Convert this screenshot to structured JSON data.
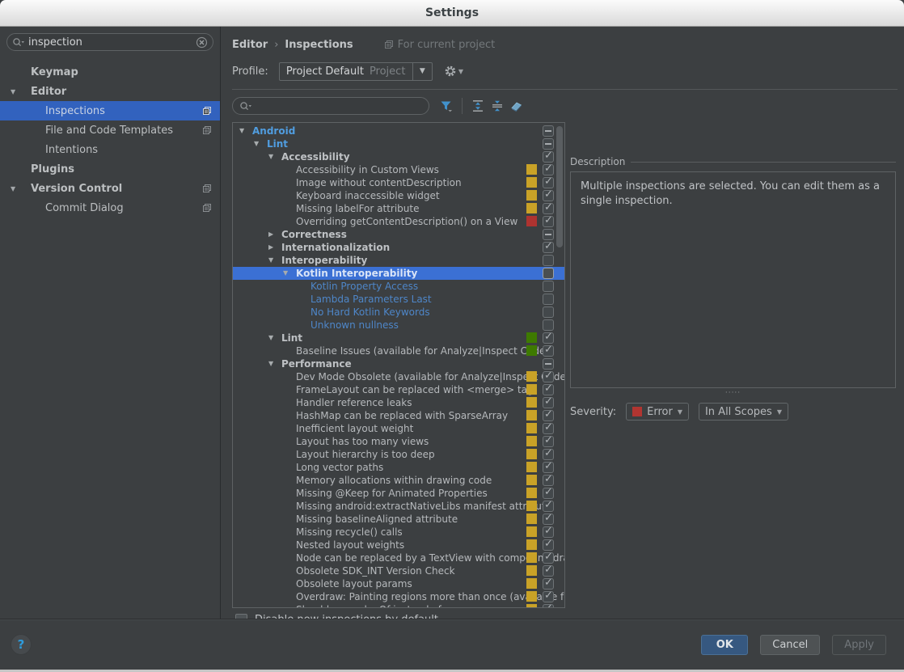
{
  "window": {
    "title": "Settings",
    "help_glyph": "?"
  },
  "sidebar": {
    "search": {
      "value": "inspection",
      "left_icon": "magnifier-with-dropdown-icon",
      "right_icon": "clear-circle-icon"
    },
    "items": [
      {
        "label": "Keymap",
        "style": "group"
      },
      {
        "label": "Editor",
        "style": "group",
        "arrow": "down"
      },
      {
        "label": "Inspections",
        "style": "child",
        "selected": true,
        "icon": true
      },
      {
        "label": "File and Code Templates",
        "style": "child",
        "icon": true
      },
      {
        "label": "Intentions",
        "style": "child"
      },
      {
        "label": "Plugins",
        "style": "group"
      },
      {
        "label": "Version Control",
        "style": "group",
        "arrow": "down",
        "icon": true
      },
      {
        "label": "Commit Dialog",
        "style": "child",
        "icon": true
      }
    ]
  },
  "header": {
    "breadcrumb": [
      "Editor",
      "Inspections"
    ],
    "separator": "›",
    "context": {
      "icon": "copy-pages-icon",
      "label": "For current project"
    }
  },
  "profile": {
    "label": "Profile:",
    "value": "Project Default",
    "scope": "Project",
    "gear_icon": "gear-with-dropdown-icon"
  },
  "tree_toolbar": {
    "search": {
      "value": ""
    },
    "icons": [
      "filter-funnel-icon",
      "expand-all-icon",
      "collapse-all-icon",
      "reset-eraser-icon"
    ]
  },
  "severity_colors": {
    "yellow": "#C9A227",
    "red": "#AE3330",
    "green": "#3E7A00"
  },
  "inspection_tree": {
    "rows": [
      {
        "label": "Android",
        "level": 0,
        "arrow": "down",
        "style": "cat-blue",
        "check": "dash"
      },
      {
        "label": "Lint",
        "level": 1,
        "arrow": "down",
        "style": "cat-blue",
        "check": "dash"
      },
      {
        "label": "Accessibility",
        "level": 2,
        "arrow": "down",
        "style": "cat",
        "check": "check"
      },
      {
        "label": "Accessibility in Custom Views",
        "level": 3,
        "style": "item",
        "sev": "yellow",
        "check": "check"
      },
      {
        "label": "Image without contentDescription",
        "level": 3,
        "style": "item",
        "sev": "yellow",
        "check": "check"
      },
      {
        "label": "Keyboard inaccessible widget",
        "level": 3,
        "style": "item",
        "sev": "yellow",
        "check": "check"
      },
      {
        "label": "Missing labelFor attribute",
        "level": 3,
        "style": "item",
        "sev": "yellow",
        "check": "check"
      },
      {
        "label": "Overriding getContentDescription() on a View",
        "level": 3,
        "style": "item",
        "sev": "red",
        "check": "check"
      },
      {
        "label": "Correctness",
        "level": 2,
        "arrow": "right",
        "style": "cat",
        "check": "dash"
      },
      {
        "label": "Internationalization",
        "level": 2,
        "arrow": "right",
        "style": "cat",
        "check": "check"
      },
      {
        "label": "Interoperability",
        "level": 2,
        "arrow": "down",
        "style": "cat",
        "check": "empty"
      },
      {
        "label": "Kotlin Interoperability",
        "level": 3,
        "arrow": "down",
        "style": "cat-sel",
        "check": "empty",
        "selected": true
      },
      {
        "label": "Kotlin Property Access",
        "level": 4,
        "style": "item-blue",
        "check": "empty"
      },
      {
        "label": "Lambda Parameters Last",
        "level": 4,
        "style": "item-blue",
        "check": "empty"
      },
      {
        "label": "No Hard Kotlin Keywords",
        "level": 4,
        "style": "item-blue",
        "check": "empty"
      },
      {
        "label": "Unknown nullness",
        "level": 4,
        "style": "item-blue",
        "check": "empty"
      },
      {
        "label": "Lint",
        "level": 2,
        "arrow": "down",
        "style": "cat",
        "sev": "green",
        "check": "check"
      },
      {
        "label": "Baseline Issues (available for Analyze|Inspect Code)",
        "level": 3,
        "style": "item",
        "sev": "green",
        "check": "check"
      },
      {
        "label": "Performance",
        "level": 2,
        "arrow": "down",
        "style": "cat",
        "check": "dash"
      },
      {
        "label": "Dev Mode Obsolete (available for Analyze|Inspect Code)",
        "level": 3,
        "style": "item",
        "sev": "yellow",
        "check": "check"
      },
      {
        "label": "FrameLayout can be replaced with <merge> tag",
        "level": 3,
        "style": "item",
        "sev": "yellow",
        "check": "check"
      },
      {
        "label": "Handler reference leaks",
        "level": 3,
        "style": "item",
        "sev": "yellow",
        "check": "check"
      },
      {
        "label": "HashMap can be replaced with SparseArray",
        "level": 3,
        "style": "item",
        "sev": "yellow",
        "check": "check"
      },
      {
        "label": "Inefficient layout weight",
        "level": 3,
        "style": "item",
        "sev": "yellow",
        "check": "check"
      },
      {
        "label": "Layout has too many views",
        "level": 3,
        "style": "item",
        "sev": "yellow",
        "check": "check"
      },
      {
        "label": "Layout hierarchy is too deep",
        "level": 3,
        "style": "item",
        "sev": "yellow",
        "check": "check"
      },
      {
        "label": "Long vector paths",
        "level": 3,
        "style": "item",
        "sev": "yellow",
        "check": "check"
      },
      {
        "label": "Memory allocations within drawing code",
        "level": 3,
        "style": "item",
        "sev": "yellow",
        "check": "check"
      },
      {
        "label": "Missing @Keep for Animated Properties",
        "level": 3,
        "style": "item",
        "sev": "yellow",
        "check": "check"
      },
      {
        "label": "Missing android:extractNativeLibs manifest attribute",
        "level": 3,
        "style": "item",
        "sev": "yellow",
        "check": "check"
      },
      {
        "label": "Missing baselineAligned attribute",
        "level": 3,
        "style": "item",
        "sev": "yellow",
        "check": "check"
      },
      {
        "label": "Missing recycle() calls",
        "level": 3,
        "style": "item",
        "sev": "yellow",
        "check": "check"
      },
      {
        "label": "Nested layout weights",
        "level": 3,
        "style": "item",
        "sev": "yellow",
        "check": "check"
      },
      {
        "label": "Node can be replaced by a TextView with compound drawables",
        "level": 3,
        "style": "item",
        "sev": "yellow",
        "check": "check"
      },
      {
        "label": "Obsolete SDK_INT Version Check",
        "level": 3,
        "style": "item",
        "sev": "yellow",
        "check": "check"
      },
      {
        "label": "Obsolete layout params",
        "level": 3,
        "style": "item",
        "sev": "yellow",
        "check": "check"
      },
      {
        "label": "Overdraw: Painting regions more than once (available for Analyze|Inspect Code)",
        "level": 3,
        "style": "item",
        "sev": "yellow",
        "check": "check"
      },
      {
        "label": "Should use valueOf instead of new",
        "level": 3,
        "style": "item",
        "sev": "yellow",
        "check": "check"
      }
    ]
  },
  "description": {
    "title": "Description",
    "body": "Multiple inspections are selected. You can edit them as a single inspection."
  },
  "severity": {
    "label": "Severity:",
    "value": "Error",
    "value_color": "#B13531",
    "scope": "In All Scopes"
  },
  "options": {
    "disable_new": "Disable new inspections by default",
    "checked": false
  },
  "buttons": {
    "ok": "OK",
    "cancel": "Cancel",
    "apply": "Apply"
  }
}
